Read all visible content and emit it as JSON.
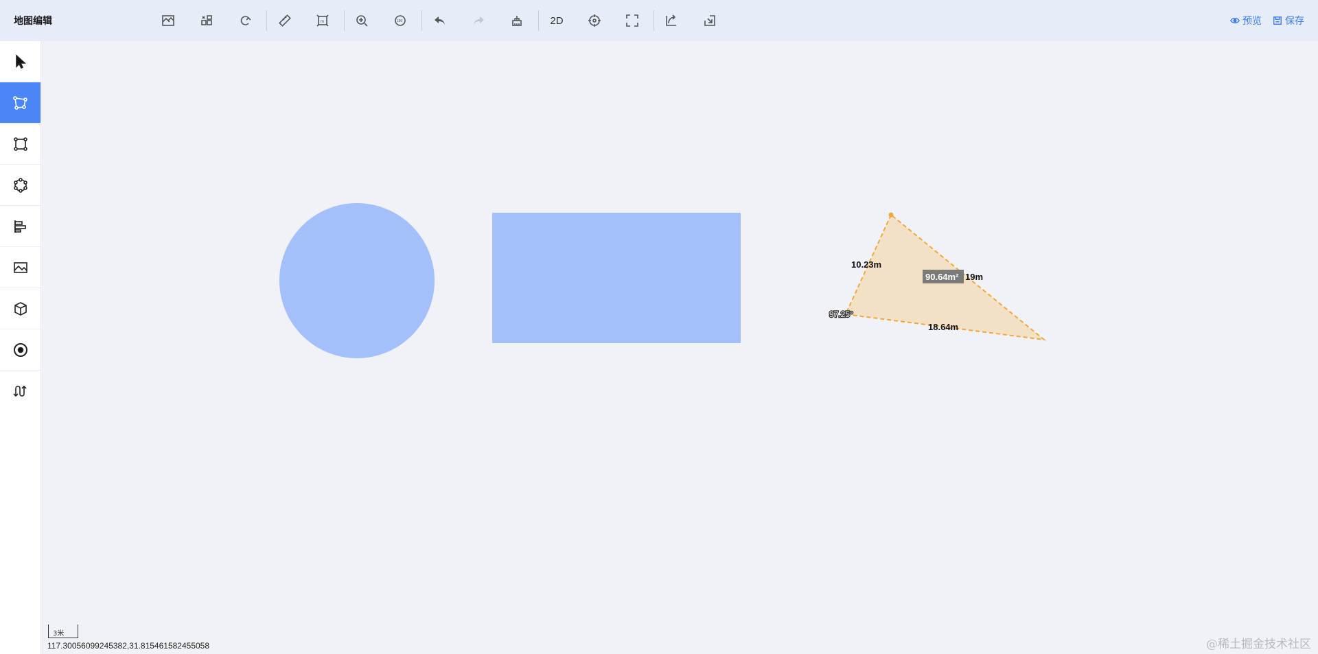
{
  "app": {
    "title": "地图编辑"
  },
  "toolbar": {
    "tools": [
      {
        "name": "basemap-icon"
      },
      {
        "name": "layers-icon"
      },
      {
        "name": "snap-icon"
      },
      {
        "name": "measure-ruler-icon"
      },
      {
        "name": "measure-area-icon"
      },
      {
        "name": "zoom-in-icon"
      },
      {
        "name": "rotate-icon"
      },
      {
        "name": "undo-icon"
      },
      {
        "name": "redo-icon"
      },
      {
        "name": "clear-icon"
      },
      {
        "name": "view-mode-2d"
      },
      {
        "name": "locate-icon"
      },
      {
        "name": "fullscreen-icon"
      },
      {
        "name": "import-icon"
      },
      {
        "name": "export-icon"
      }
    ],
    "view_mode_label": "2D",
    "preview_label": "预览",
    "save_label": "保存"
  },
  "sidebar": {
    "items": [
      {
        "name": "select-tool"
      },
      {
        "name": "polygon-tool",
        "active": true
      },
      {
        "name": "rectangle-tool"
      },
      {
        "name": "circle-tool"
      },
      {
        "name": "align-tool"
      },
      {
        "name": "image-tool"
      },
      {
        "name": "model-3d-tool"
      },
      {
        "name": "point-tool"
      },
      {
        "name": "route-tool"
      }
    ]
  },
  "map": {
    "shape_fill": "#a3c0fb",
    "measure_fill": "#f2dfc2",
    "measure_stroke": "#f2a73b",
    "measurements": {
      "side_a": "10.23m",
      "side_b": "19m",
      "side_c": "18.64m",
      "area": "90.64m²",
      "angle": "97.25°"
    }
  },
  "status": {
    "scale_label": "3米",
    "coordinates": "117.30056099245382,31.815461582455058"
  },
  "watermark": "@稀土掘金技术社区"
}
